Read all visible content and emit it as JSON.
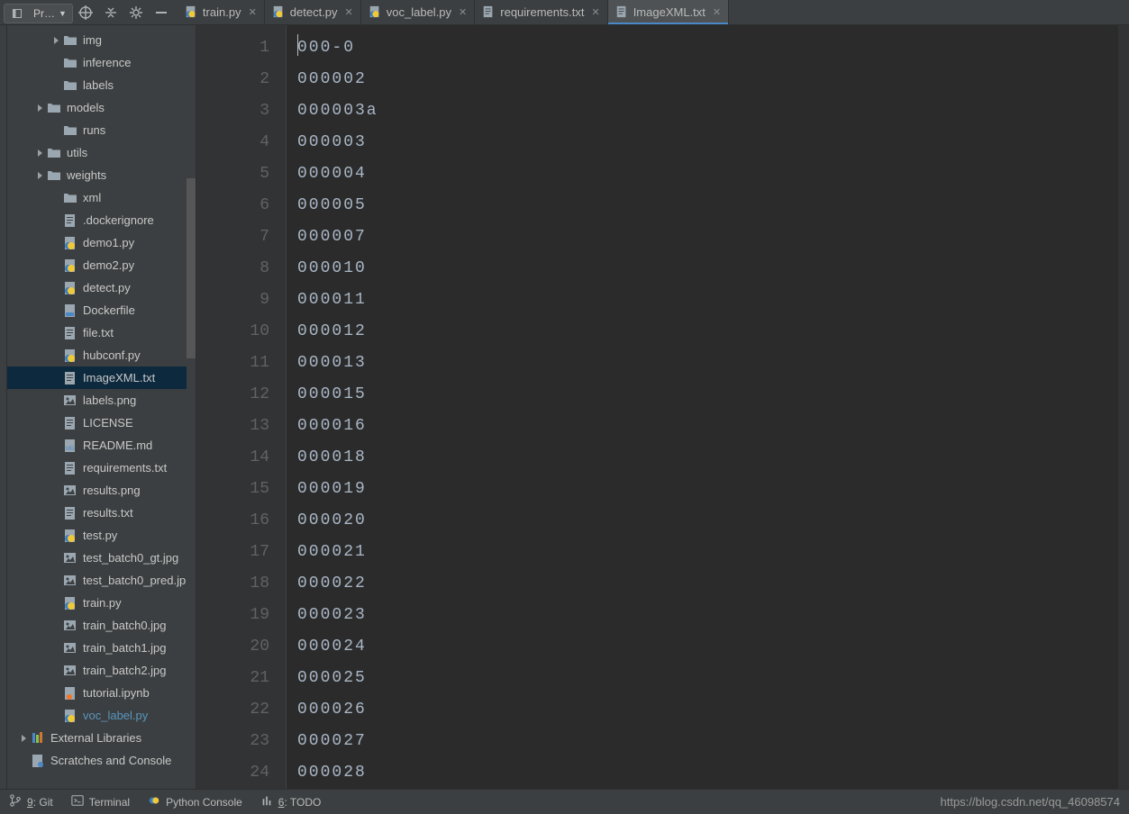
{
  "toolbar": {
    "project_label": "Pr…"
  },
  "tabs": [
    {
      "name": "train.py",
      "type": "py",
      "active": false
    },
    {
      "name": "detect.py",
      "type": "py",
      "active": false
    },
    {
      "name": "voc_label.py",
      "type": "py",
      "active": false
    },
    {
      "name": "requirements.txt",
      "type": "txt",
      "active": false
    },
    {
      "name": "ImageXML.txt",
      "type": "txt",
      "active": true
    }
  ],
  "tree": [
    {
      "depth": 2,
      "arrow": "right",
      "icon": "folder",
      "label": "img"
    },
    {
      "depth": 2,
      "arrow": "none",
      "icon": "folder",
      "label": "inference"
    },
    {
      "depth": 2,
      "arrow": "none",
      "icon": "folder",
      "label": "labels"
    },
    {
      "depth": 1,
      "arrow": "right",
      "icon": "folder",
      "label": "models"
    },
    {
      "depth": 2,
      "arrow": "none",
      "icon": "folder",
      "label": "runs"
    },
    {
      "depth": 1,
      "arrow": "right",
      "icon": "folder",
      "label": "utils"
    },
    {
      "depth": 1,
      "arrow": "right",
      "icon": "folder",
      "label": "weights"
    },
    {
      "depth": 2,
      "arrow": "none",
      "icon": "folder",
      "label": "xml"
    },
    {
      "depth": 2,
      "arrow": "none",
      "icon": "txt",
      "label": ".dockerignore"
    },
    {
      "depth": 2,
      "arrow": "none",
      "icon": "py",
      "label": "demo1.py"
    },
    {
      "depth": 2,
      "arrow": "none",
      "icon": "py",
      "label": "demo2.py"
    },
    {
      "depth": 2,
      "arrow": "none",
      "icon": "py",
      "label": "detect.py"
    },
    {
      "depth": 2,
      "arrow": "none",
      "icon": "docker",
      "label": "Dockerfile"
    },
    {
      "depth": 2,
      "arrow": "none",
      "icon": "txt",
      "label": "file.txt"
    },
    {
      "depth": 2,
      "arrow": "none",
      "icon": "py",
      "label": "hubconf.py"
    },
    {
      "depth": 2,
      "arrow": "none",
      "icon": "txt",
      "label": "ImageXML.txt",
      "selected": true
    },
    {
      "depth": 2,
      "arrow": "none",
      "icon": "img",
      "label": "labels.png"
    },
    {
      "depth": 2,
      "arrow": "none",
      "icon": "txt",
      "label": "LICENSE"
    },
    {
      "depth": 2,
      "arrow": "none",
      "icon": "md",
      "label": "README.md"
    },
    {
      "depth": 2,
      "arrow": "none",
      "icon": "txt",
      "label": "requirements.txt"
    },
    {
      "depth": 2,
      "arrow": "none",
      "icon": "img",
      "label": "results.png"
    },
    {
      "depth": 2,
      "arrow": "none",
      "icon": "txt",
      "label": "results.txt"
    },
    {
      "depth": 2,
      "arrow": "none",
      "icon": "py",
      "label": "test.py"
    },
    {
      "depth": 2,
      "arrow": "none",
      "icon": "img",
      "label": "test_batch0_gt.jpg"
    },
    {
      "depth": 2,
      "arrow": "none",
      "icon": "img",
      "label": "test_batch0_pred.jp"
    },
    {
      "depth": 2,
      "arrow": "none",
      "icon": "py",
      "label": "train.py"
    },
    {
      "depth": 2,
      "arrow": "none",
      "icon": "img",
      "label": "train_batch0.jpg"
    },
    {
      "depth": 2,
      "arrow": "none",
      "icon": "img",
      "label": "train_batch1.jpg"
    },
    {
      "depth": 2,
      "arrow": "none",
      "icon": "img",
      "label": "train_batch2.jpg"
    },
    {
      "depth": 2,
      "arrow": "none",
      "icon": "ipynb",
      "label": "tutorial.ipynb"
    },
    {
      "depth": 2,
      "arrow": "none",
      "icon": "py",
      "label": "voc_label.py",
      "blue": true
    },
    {
      "depth": 0,
      "arrow": "right",
      "icon": "lib",
      "label": "External Libraries"
    },
    {
      "depth": 0,
      "arrow": "none",
      "icon": "scratch",
      "label": "Scratches and Console"
    }
  ],
  "editor": {
    "lines": [
      "000-0",
      "000002",
      "000003a",
      "000003",
      "000004",
      "000005",
      "000007",
      "000010",
      "000011",
      "000012",
      "000013",
      "000015",
      "000016",
      "000018",
      "000019",
      "000020",
      "000021",
      "000022",
      "000023",
      "000024",
      "000025",
      "000026",
      "000027",
      "000028"
    ]
  },
  "status": {
    "git": "9: Git",
    "terminal": "Terminal",
    "python_console": "Python Console",
    "todo": "6: TODO"
  },
  "watermark": "https://blog.csdn.net/qq_46098574"
}
